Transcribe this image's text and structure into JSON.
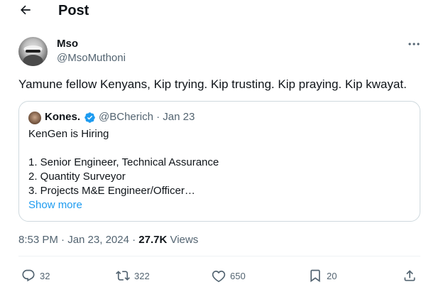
{
  "header": {
    "title": "Post"
  },
  "tweet": {
    "author_name": "Mso",
    "author_handle": "@MsoMuthoni",
    "text": "Yamune fellow Kenyans, Kip trying. Kip  trusting. Kip praying. Kip kwayat.",
    "quoted": {
      "author_name": "Kones.",
      "meta": "@BCherich · Jan 23",
      "lines": [
        "KenGen is Hiring",
        "",
        "1. Senior Engineer, Technical Assurance",
        "2. Quantity Surveyor",
        "3. Projects M&E Engineer/Officer…"
      ],
      "show_more": "Show more"
    },
    "timestamp": "8:53 PM · Jan 23, 2024 · ",
    "views_count": "27.7K",
    "views_label": " Views"
  },
  "actions": {
    "replies": "32",
    "reposts": "322",
    "likes": "650",
    "bookmarks": "20"
  },
  "icons": {
    "back": "arrow-left-icon",
    "more": "more-horizontal-icon",
    "verified": "verified-badge-icon",
    "reply": "reply-icon",
    "repost": "repost-icon",
    "like": "heart-icon",
    "bookmark": "bookmark-icon",
    "share": "share-icon"
  },
  "colors": {
    "accent": "#1d9bf0",
    "text": "#0f1419",
    "secondary": "#536471",
    "border": "#cfd9de"
  }
}
